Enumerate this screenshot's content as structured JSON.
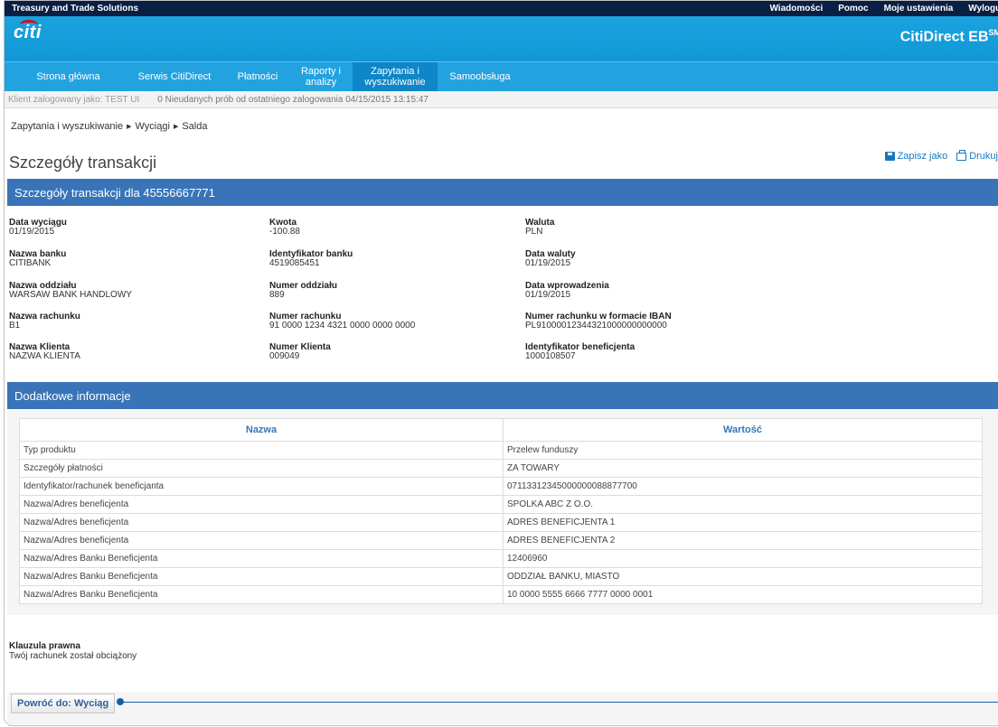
{
  "topbar": {
    "org": "Treasury and Trade Solutions",
    "links": [
      "Wiadomości",
      "Pomoc",
      "Moje ustawienia",
      "Wyloguj"
    ]
  },
  "brand": {
    "logo": "citi",
    "product": "CitiDirect EB",
    "product_sup": "SM"
  },
  "nav": {
    "items": [
      {
        "label": "Strona główna"
      },
      {
        "label": "Serwis CitiDirect"
      },
      {
        "label": "Płatności"
      },
      {
        "label": "Raporty i analizy"
      },
      {
        "label": "Zapytania i wyszukiwanie",
        "active": true
      },
      {
        "label": "Samoobsługa"
      }
    ]
  },
  "infobar": {
    "user": "Klient zalogowany jako: TEST UI",
    "attempts": "0 Nieudanych prób od ostatniego zalogowania 04/15/2015 13:15:47"
  },
  "breadcrumb": [
    "Zapytania i wyszukiwanie",
    "Wyciągi",
    "Salda"
  ],
  "page_title": "Szczegóły transakcji",
  "actions": {
    "save": "Zapisz jako",
    "print": "Drukuj"
  },
  "details_header": "Szczegóły transakcji dla 45556667771",
  "fields": [
    {
      "label": "Data wyciągu",
      "value": "01/19/2015"
    },
    {
      "label": "Kwota",
      "value": "-100.88"
    },
    {
      "label": "Waluta",
      "value": "PLN"
    },
    {
      "label": "Nazwa banku",
      "value": "CITIBANK"
    },
    {
      "label": "Identyfikator banku",
      "value": "4519085451"
    },
    {
      "label": "Data waluty",
      "value": "01/19/2015"
    },
    {
      "label": "Nazwa oddziału",
      "value": "WARSAW BANK HANDLOWY"
    },
    {
      "label": "Numer oddziału",
      "value": "889"
    },
    {
      "label": "Data wprowadzenia",
      "value": "01/19/2015"
    },
    {
      "label": "Nazwa rachunku",
      "value": "B1"
    },
    {
      "label": "Numer rachunku",
      "value": "91 0000 1234 4321 0000 0000 0000"
    },
    {
      "label": "Numer rachunku w formacie IBAN",
      "value": "PL91000012344321000000000000"
    },
    {
      "label": "Nazwa Klienta",
      "value": "NAZWA KLIENTA"
    },
    {
      "label": "Numer Klienta",
      "value": "009049"
    },
    {
      "label": "Identyfikator beneficjenta",
      "value": "1000108507"
    }
  ],
  "additional_header": "Dodatkowe informacje",
  "additional_table": {
    "columns": [
      "Nazwa",
      "Wartość"
    ],
    "rows": [
      [
        "Typ produktu",
        "Przelew funduszy"
      ],
      [
        "Szczegóły płatności",
        "ZA TOWARY"
      ],
      [
        "Identyfikator/rachunek beneficjanta",
        "07113312345000000088877700"
      ],
      [
        "Nazwa/Adres beneficjenta",
        "SPOLKA ABC Z O.O."
      ],
      [
        "Nazwa/Adres beneficjenta",
        "ADRES BENEFICJENTA 1"
      ],
      [
        "Nazwa/Adres beneficjenta",
        "ADRES BENEFICJENTA 2"
      ],
      [
        "Nazwa/Adres Banku Beneficjenta",
        "12406960"
      ],
      [
        "Nazwa/Adres Banku Beneficjenta",
        "ODDZIAŁ BANKU, MIASTO"
      ],
      [
        "Nazwa/Adres Banku Beneficjenta",
        "10 0000 5555 6666 7777 0000 0001"
      ]
    ]
  },
  "legal": {
    "label": "Klauzula prawna",
    "text": "Twój rachunek został obciążony"
  },
  "back_button": "Powróć do: Wyciąg"
}
